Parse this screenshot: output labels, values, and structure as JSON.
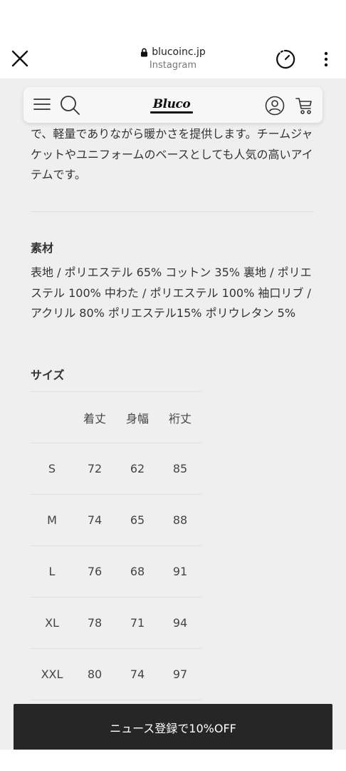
{
  "browser": {
    "url": "blucoinc.jp",
    "source": "Instagram"
  },
  "header": {
    "logo_text": "Bluco"
  },
  "product": {
    "description_tail": "で、軽量でありながら暖かさを提供します。チームジャケットやユニフォームのベースとしても人気の高いアイテムです。",
    "material_title": "素材",
    "material_text": "表地 / ポリエステル 65% コットン 35% 裏地 / ポリエステル 100% 中わた / ポリエステル 100% 袖口リブ / アクリル 80% ポリエステル15% ポリウレタン 5%",
    "size_title": "サイズ",
    "size_table": {
      "headers": [
        "",
        "着丈",
        "身幅",
        "裄丈"
      ],
      "rows": [
        [
          "S",
          "72",
          "62",
          "85"
        ],
        [
          "M",
          "74",
          "65",
          "88"
        ],
        [
          "L",
          "76",
          "68",
          "91"
        ],
        [
          "XL",
          "78",
          "71",
          "94"
        ],
        [
          "XXL",
          "80",
          "74",
          "97"
        ]
      ]
    }
  },
  "newsletter": {
    "label": "ニュース登録で10%OFF"
  },
  "colors": {
    "page_bg": "#efefef",
    "banner_bg": "#262626",
    "text": "#333333"
  }
}
